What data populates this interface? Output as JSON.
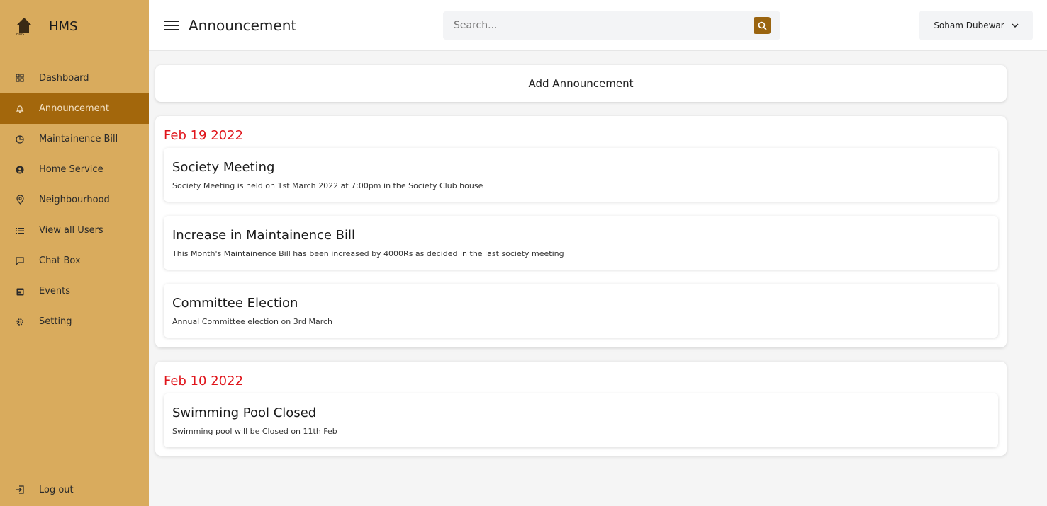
{
  "brand": {
    "name": "HMS",
    "logo_caption": "HMS"
  },
  "sidebar": {
    "items": [
      {
        "label": "Dashboard",
        "icon": "grid-icon"
      },
      {
        "label": "Announcement",
        "icon": "bell-icon",
        "active": true
      },
      {
        "label": "Maintainence Bill",
        "icon": "pie-chart-icon"
      },
      {
        "label": "Home Service",
        "icon": "user-circle-icon"
      },
      {
        "label": "Neighbourhood",
        "icon": "location-pin-icon"
      },
      {
        "label": "View all Users",
        "icon": "list-icon"
      },
      {
        "label": "Chat Box",
        "icon": "chat-icon"
      },
      {
        "label": "Events",
        "icon": "calendar-icon"
      },
      {
        "label": "Setting",
        "icon": "gear-icon"
      }
    ],
    "logout_label": "Log out"
  },
  "header": {
    "title": "Announcement",
    "search_placeholder": "Search...",
    "user_name": "Soham Dubewar"
  },
  "main": {
    "add_label": "Add Announcement",
    "groups": [
      {
        "date": "Feb 19 2022",
        "items": [
          {
            "title": "Society Meeting",
            "body": "Society Meeting is held on 1st March 2022 at 7:00pm in the Society Club house"
          },
          {
            "title": "Increase in Maintainence Bill",
            "body": "This Month's Maintainence Bill has been increased by 4000Rs as decided in the last society meeting"
          },
          {
            "title": "Committee Election",
            "body": "Annual Committee election on 3rd March"
          }
        ]
      },
      {
        "date": "Feb 10 2022",
        "items": [
          {
            "title": "Swimming Pool Closed",
            "body": "Swimming pool will be Closed on 11th Feb"
          }
        ]
      }
    ]
  },
  "colors": {
    "sidebar_bg": "#d9ab5d",
    "active_bg": "#a3670c",
    "date_red": "#e0151b",
    "search_btn": "#9a6410"
  }
}
